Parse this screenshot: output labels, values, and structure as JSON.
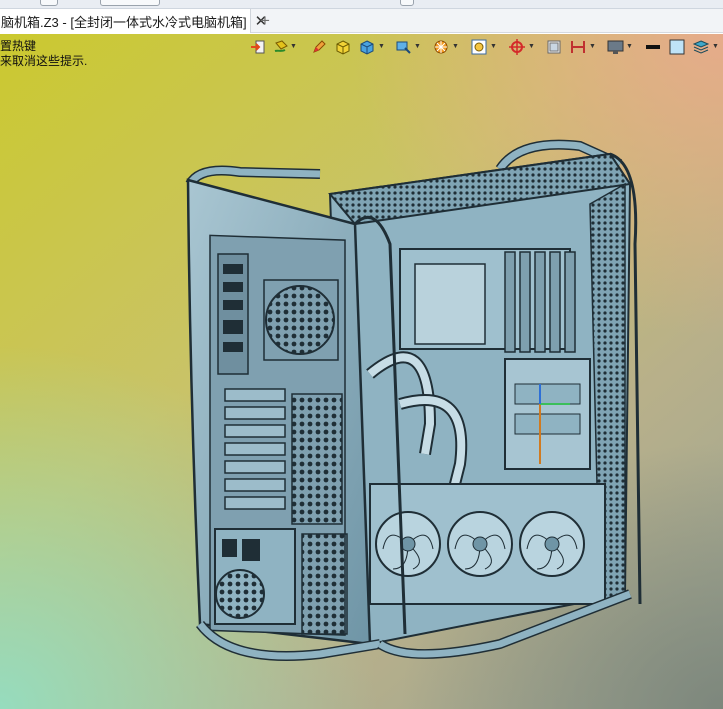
{
  "tab": {
    "title": "脑机箱.Z3 - [全封闭一体式水冷式电脑机箱]",
    "close_glyph": "✕",
    "new_glyph": "+"
  },
  "viewport": {
    "hint_line1": "置热键",
    "hint_line2": "来取消这些提示."
  },
  "toolbar": {
    "icons": [
      "import-icon",
      "paint-icon",
      "pen-icon",
      "cube-yellow-icon",
      "cube-blue-icon",
      "box-select-icon",
      "wheel-icon",
      "zoom-box-icon",
      "crosshair-icon",
      "layer-icon",
      "dimension-icon",
      "monitor-icon",
      "line-black-icon",
      "square-blue-icon",
      "stack-icon"
    ]
  },
  "colors": {
    "model_fill": "#8fb3c2",
    "model_line": "#1f2e36"
  }
}
